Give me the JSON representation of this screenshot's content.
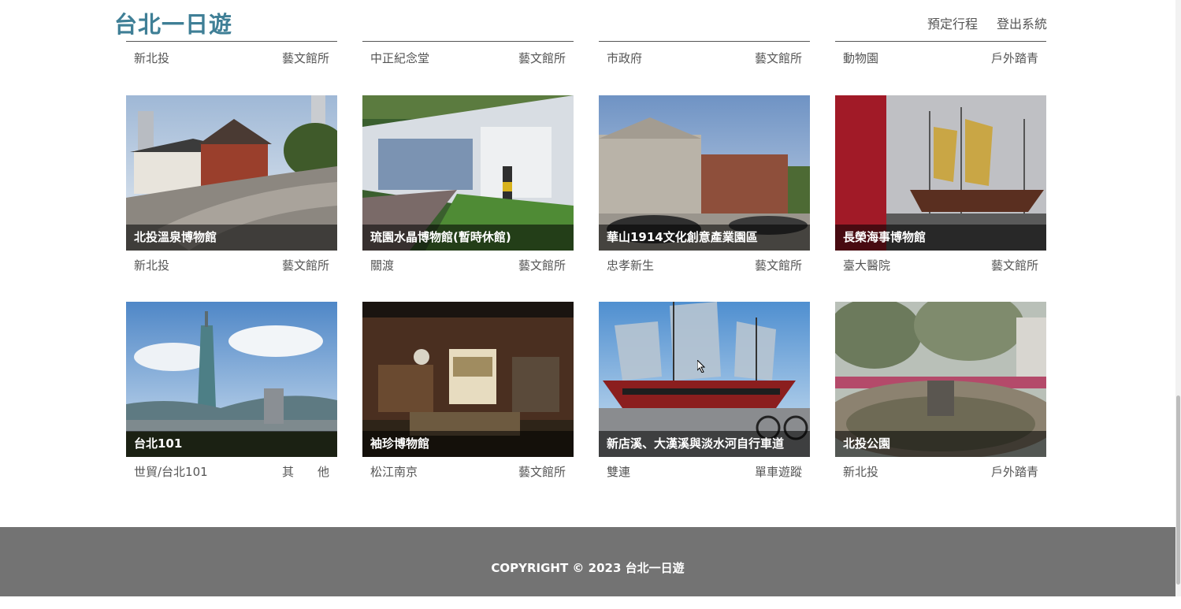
{
  "header": {
    "brand": "台北一日遊",
    "nav": [
      "預定行程",
      "登出系統"
    ]
  },
  "partial_row": [
    {
      "district": "新北投",
      "category": "藝文館所"
    },
    {
      "district": "中正紀念堂",
      "category": "藝文館所"
    },
    {
      "district": "市政府",
      "category": "藝文館所"
    },
    {
      "district": "動物園",
      "category": "戶外踏青"
    }
  ],
  "row2": [
    {
      "title": "北投溫泉博物館",
      "district": "新北投",
      "category": "藝文館所"
    },
    {
      "title": "琉園水晶博物館(暫時休館)",
      "district": "關渡",
      "category": "藝文館所"
    },
    {
      "title": "華山1914文化創意產業園區",
      "district": "忠孝新生",
      "category": "藝文館所"
    },
    {
      "title": "長榮海事博物館",
      "district": "臺大醫院",
      "category": "藝文館所"
    }
  ],
  "row3": [
    {
      "title": "台北101",
      "district": "世貿/台北101",
      "category": "其　　他"
    },
    {
      "title": "袖珍博物館",
      "district": "松江南京",
      "category": "藝文館所"
    },
    {
      "title": "新店溪、大漢溪與淡水河自行車道",
      "district": "雙連",
      "category": "單車遊蹤"
    },
    {
      "title": "北投公園",
      "district": "新北投",
      "category": "戶外踏青"
    }
  ],
  "footer": {
    "copyright": "COPYRIGHT © 2023 台北一日遊"
  }
}
